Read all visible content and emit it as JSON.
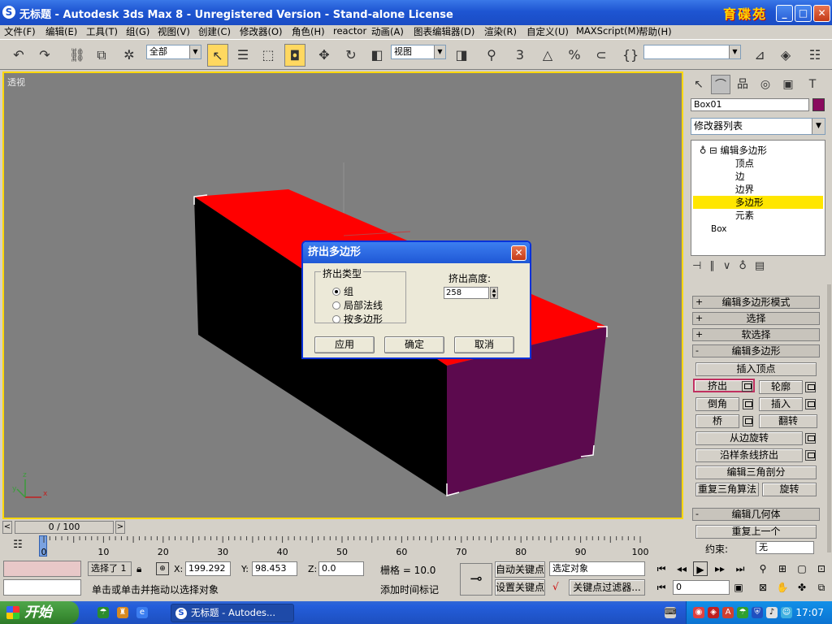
{
  "window": {
    "app_icon": "3ds-max-icon",
    "app_icon_glyph": "S",
    "title": "无标题 - Autodesk 3ds Max 8 - Unregistered Version - Stand-alone License",
    "logo_text": "育碟苑",
    "buttons": {
      "minimize": "_",
      "maximize": "□",
      "close": "✕"
    }
  },
  "menu": {
    "items": [
      "文件(F)",
      "编辑(E)",
      "工具(T)",
      "组(G)",
      "视图(V)",
      "创建(C)",
      "修改器(O)",
      "角色(H)",
      "reactor",
      "动画(A)",
      "图表编辑器(D)",
      "渲染(R)",
      "自定义(U)",
      "MAXScript(M)",
      "帮助(H)"
    ]
  },
  "toolbar": {
    "selection_filter": "全部",
    "reference_coord": "视图",
    "named_selection": "",
    "snap_labels": [
      "3",
      "%"
    ]
  },
  "viewport": {
    "label": "透视",
    "axis_labels": {
      "x": "x",
      "y": "y",
      "z": "z"
    },
    "colors": {
      "background": "#7f7f7f",
      "top_face": "#ff0000",
      "front_face": "#000000",
      "side_face": "#5c0a4e",
      "border": "#ffd800"
    }
  },
  "dialog": {
    "title": "挤出多边形",
    "group_label": "挤出类型",
    "options": [
      {
        "label": "组",
        "selected": true
      },
      {
        "label": "局部法线",
        "selected": false
      },
      {
        "label": "按多边形",
        "selected": false
      }
    ],
    "height_label": "挤出高度:",
    "height_value": "258",
    "buttons": {
      "apply": "应用",
      "ok": "确定",
      "cancel": "取消"
    }
  },
  "command_panel": {
    "object_name": "Box01",
    "object_color": "#8a0a5e",
    "modifier_list": "修改器列表",
    "stack": {
      "modifier": "编辑多边形",
      "subobjects": [
        "顶点",
        "边",
        "边界",
        "多边形",
        "元素"
      ],
      "selected": "多边形",
      "base": "Box"
    },
    "rollouts": {
      "mode": "编辑多边形模式",
      "selection": "选择",
      "soft_selection": "软选择",
      "edit_polygons": "编辑多边形",
      "edit_geometry": "编辑几何体"
    },
    "edit_poly_buttons": {
      "insert_vertex": "插入顶点",
      "extrude": "挤出",
      "outline": "轮廓",
      "bevel": "倒角",
      "inset": "插入",
      "bridge": "桥",
      "flip": "翻转",
      "hinge_from_edge": "从边旋转",
      "extrude_along_spline": "沿样条线挤出",
      "edit_triangulation": "编辑三角剖分",
      "retriangulate": "重复三角算法",
      "turn": "旋转"
    },
    "edit_geometry": {
      "repeat_last": "重复上一个",
      "constraint_label": "约束:",
      "constraint_value": "无"
    }
  },
  "timeline": {
    "frame_display": "0 / 100",
    "current_frame": 0,
    "total_frames": 100,
    "ticks": [
      "0",
      "10",
      "20",
      "30",
      "40",
      "50",
      "60",
      "70",
      "80",
      "90",
      "100"
    ]
  },
  "status": {
    "selection_count": "选择了 1",
    "x_label": "X:",
    "x_value": "199.292",
    "y_label": "Y:",
    "y_value": "98.453",
    "z_label": "Z:",
    "z_value": "0.0",
    "grid": "栅格 = 10.0",
    "prompt": "单击或单击并拖动以选择对象",
    "add_time_tag": "添加时间标记",
    "auto_key": "自动关键点",
    "set_key": "设置关键点",
    "key_mode": "选定对象",
    "key_filters": "关键点过滤器...",
    "frame_field": "0"
  },
  "taskbar": {
    "start_label": "开始",
    "task_button": "无标题 - Autodes...",
    "clock": "17:07"
  }
}
